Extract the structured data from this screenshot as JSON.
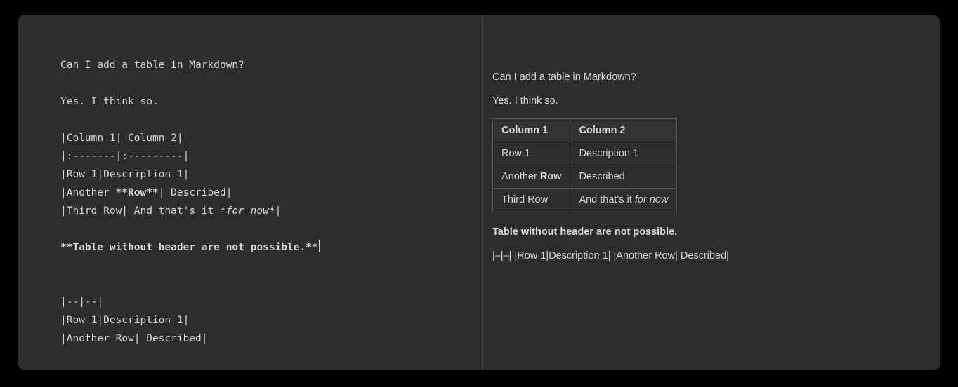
{
  "editor": {
    "line1": "Can I add a table in Markdown?",
    "line2": "Yes. I think so.",
    "line3": "|Column 1| Column 2|",
    "line4": "|:-------|:---------|",
    "line5": "|Row 1|Description 1|",
    "line6_prefix": "|Another ",
    "line6_bold": "**Row**",
    "line6_suffix": "| Described|",
    "line7_prefix": "|Third Row| And that's it ",
    "line7_ital": "*for now*",
    "line7_suffix": "|",
    "line8_bold": "**Table without header are not possible.**",
    "line9": "|--|--|",
    "line10": "|Row 1|Description 1|",
    "line11": "|Another Row| Described|"
  },
  "preview": {
    "p1": "Can I add a table in Markdown?",
    "p2": "Yes. I think so.",
    "table": {
      "h1": "Column 1",
      "h2": "Column 2",
      "r1c1": "Row 1",
      "r1c2": "Description 1",
      "r2c1_prefix": "Another ",
      "r2c1_bold": "Row",
      "r2c2": "Described",
      "r3c1": "Third Row",
      "r3c2_prefix": "And that's it ",
      "r3c2_ital": "for now"
    },
    "bold_line": "Table without header are not possible.",
    "collapsed": "|–|–| |Row 1|Description 1| |Another Row| Described|"
  }
}
